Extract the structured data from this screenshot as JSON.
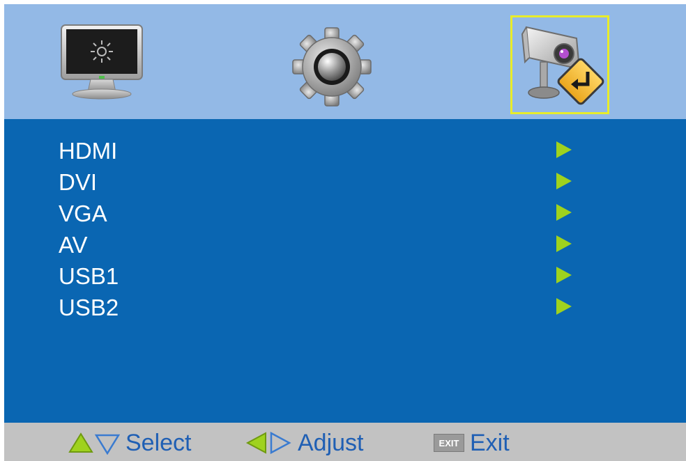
{
  "tabs": [
    {
      "icon": "monitor-icon",
      "name": "display"
    },
    {
      "icon": "gear-icon",
      "name": "settings"
    },
    {
      "icon": "camera-source-icon",
      "name": "source",
      "selected": true
    }
  ],
  "source_list": [
    {
      "label": "HDMI"
    },
    {
      "label": "DVI"
    },
    {
      "label": "VGA"
    },
    {
      "label": "AV"
    },
    {
      "label": "USB1"
    },
    {
      "label": "USB2"
    }
  ],
  "hints": {
    "select_label": "Select",
    "adjust_label": "Adjust",
    "exit_key": "EXIT",
    "exit_label": "Exit"
  },
  "colors": {
    "top_bar": "#93b9e6",
    "panel": "#0a66b2",
    "bottom_bar": "#c2c2c2",
    "arrow": "#9fd21e",
    "selection_border": "#e8ec2a",
    "hint_text": "#1f5fb4"
  }
}
